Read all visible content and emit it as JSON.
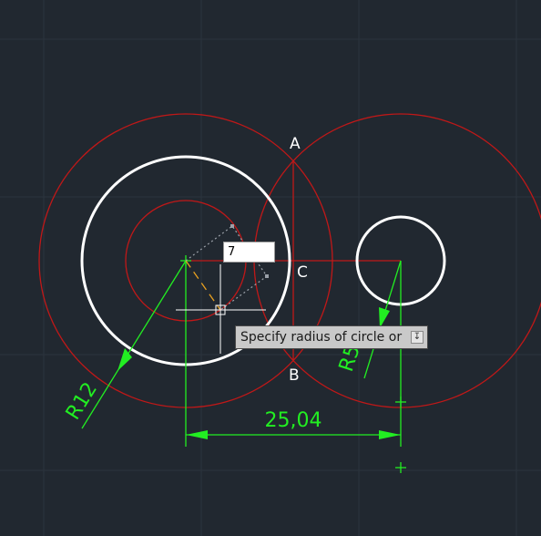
{
  "labels": {
    "point_a": "A",
    "point_b": "B",
    "point_c": "C",
    "dimension_distance": "25,04",
    "radius_left": "R12",
    "radius_right": "R5"
  },
  "input": {
    "value": "7"
  },
  "tooltip": {
    "prompt": "Specify radius of circle or",
    "options_icon": "down-arrow-icon"
  },
  "colors": {
    "background": "#212830",
    "grid": "#2c343e",
    "construction": "#c01818",
    "object": "#ffffff",
    "dimension": "#22ee22",
    "rubberband": "#e8a020"
  }
}
